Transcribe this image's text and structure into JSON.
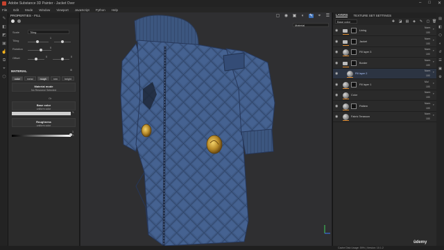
{
  "window": {
    "title": "Adobe Substance 3D Painter - Jacket Over",
    "controls": [
      "–",
      "□",
      "✕"
    ]
  },
  "menu": [
    "File",
    "Edit",
    "Mode",
    "Window",
    "Viewport",
    "JavaScript",
    "Python",
    "Help"
  ],
  "toolstrip": {
    "icons": [
      "paint-brush-icon",
      "eraser-icon",
      "projection-icon",
      "geometry-fill-icon",
      "smudge-icon",
      "clone-icon",
      "color-picker-icon",
      "polygon-fill-icon"
    ]
  },
  "properties": {
    "header": "PROPERTIES - FILL",
    "scale_label": "Scale",
    "scale_value": "Tiling",
    "tiling_label": "Tiling",
    "tiling_value": "1",
    "rotation_label": "Rotation",
    "rotation_value": "0",
    "offset_label": "Offset",
    "offset_value_1": "0",
    "offset_value_2": "0",
    "material_section": "MATERIAL",
    "channels": [
      "color",
      "metal",
      "rough",
      "nrm",
      "height"
    ],
    "active_channels": [
      "color",
      "rough"
    ],
    "material_mode_title": "Material mode",
    "material_mode_sub": "No Resource Selected",
    "or_label": "Or",
    "base_color_title": "Base color",
    "base_color_sub": "uniform color",
    "base_color_hex": "#cfcfcf",
    "roughness_title": "Roughness",
    "roughness_sub": "uniform color",
    "roughness_value": 1
  },
  "viewport": {
    "material_dropdown": "Material",
    "tools": [
      "frame-icon",
      "camera-icon",
      "screenshot-icon",
      "display-icon",
      "brush-mode-icon",
      "picker-icon",
      "render-icon"
    ]
  },
  "layers_panel": {
    "tabs": [
      "LAYERS",
      "TEXTURE SET SETTINGS"
    ],
    "active_tab": "LAYERS",
    "channel_dropdown": "Base color",
    "layers": [
      {
        "name": "Lining",
        "type": "folder",
        "blend": "Norm",
        "opacity": "100",
        "selected": false,
        "indent": false,
        "mask": true
      },
      {
        "name": "Jacket",
        "type": "folder",
        "blend": "Norm",
        "opacity": "100",
        "selected": false,
        "indent": false,
        "mask": true
      },
      {
        "name": "Fill layer 3",
        "type": "fill",
        "blend": "Norm",
        "opacity": "100",
        "selected": false,
        "indent": false,
        "mask": true
      },
      {
        "name": "Border",
        "type": "folder",
        "blend": "Norm",
        "opacity": "100",
        "selected": false,
        "indent": false,
        "mask": true
      },
      {
        "name": "Fill layer 2",
        "type": "fill",
        "blend": "Norm",
        "opacity": "100",
        "selected": true,
        "indent": true,
        "mask": false
      },
      {
        "name": "Fill layer 1",
        "type": "fill",
        "blend": "Mul",
        "opacity": "100",
        "selected": false,
        "indent": false,
        "mask": true
      },
      {
        "name": "Color",
        "type": "fill",
        "blend": "Norm",
        "opacity": "100",
        "selected": false,
        "indent": false,
        "mask": false
      },
      {
        "name": "Pattern",
        "type": "fill",
        "blend": "Norm",
        "opacity": "100",
        "selected": false,
        "indent": false,
        "mask": true
      },
      {
        "name": "Fabric Terasson",
        "type": "fill",
        "blend": "Norm",
        "opacity": "100",
        "selected": false,
        "indent": false,
        "mask": false
      }
    ]
  },
  "status": {
    "cache": "Cache Disk Usage:   59%  |  Version: 10.1.2",
    "watermark": "ûdemy"
  },
  "colors": {
    "accent": "#3d6fb5",
    "jacket": "#3f5a86",
    "opacity_bar": "#e08a2c"
  }
}
